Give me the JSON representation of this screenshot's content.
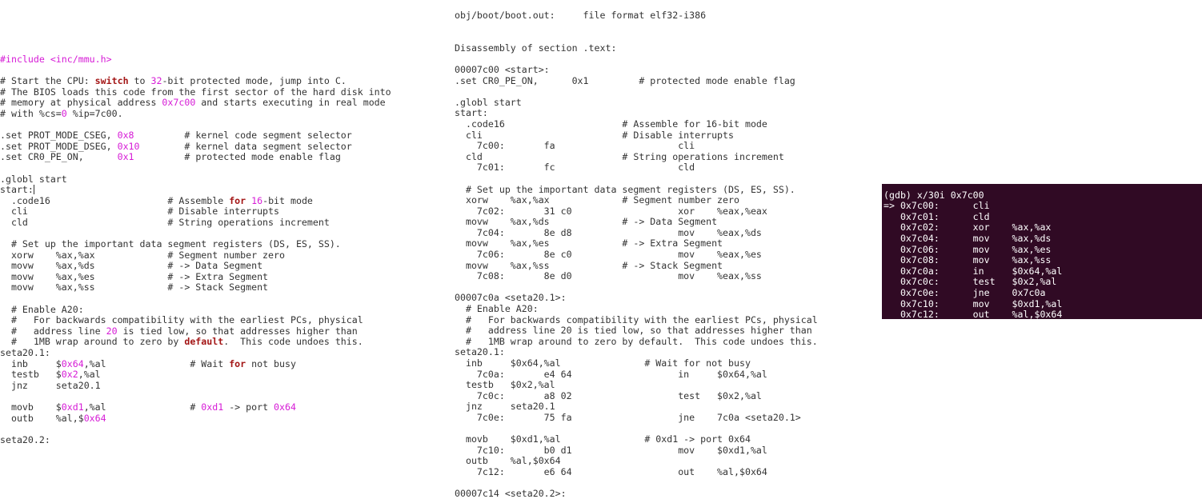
{
  "left_source": {
    "lines": [
      [
        {
          "t": "#include <inc/mmu.h>",
          "c": "pink"
        }
      ],
      [],
      [
        {
          "t": "# Start the CPU: "
        },
        {
          "t": "switch",
          "c": "kw"
        },
        {
          "t": " to "
        },
        {
          "t": "32",
          "c": "pink"
        },
        {
          "t": "-bit protected mode, jump into C."
        }
      ],
      [
        {
          "t": "# The BIOS loads this code from the first sector of the hard disk into"
        }
      ],
      [
        {
          "t": "# memory at physical address "
        },
        {
          "t": "0x7c00",
          "c": "pink"
        },
        {
          "t": " and starts executing in real mode"
        }
      ],
      [
        {
          "t": "# with %cs="
        },
        {
          "t": "0",
          "c": "pink"
        },
        {
          "t": " %ip=7c00."
        }
      ],
      [],
      [
        {
          "t": ".set PROT_MODE_CSEG, "
        },
        {
          "t": "0x8",
          "c": "pink"
        },
        {
          "t": "         # kernel code segment selector"
        }
      ],
      [
        {
          "t": ".set PROT_MODE_DSEG, "
        },
        {
          "t": "0x10",
          "c": "pink"
        },
        {
          "t": "        # kernel data segment selector"
        }
      ],
      [
        {
          "t": ".set CR0_PE_ON,      "
        },
        {
          "t": "0x1",
          "c": "pink"
        },
        {
          "t": "         # protected mode enable flag"
        }
      ],
      [],
      [
        {
          "t": ".globl start"
        }
      ],
      [
        {
          "t": "start:"
        },
        {
          "caret": true
        }
      ],
      [
        {
          "t": "  .code16                     # Assemble "
        },
        {
          "t": "for",
          "c": "kw"
        },
        {
          "t": " "
        },
        {
          "t": "16",
          "c": "pink"
        },
        {
          "t": "-bit mode"
        }
      ],
      [
        {
          "t": "  cli                         # Disable interrupts"
        }
      ],
      [
        {
          "t": "  cld                         # String operations increment"
        }
      ],
      [],
      [
        {
          "t": "  # Set up the important data segment registers (DS, ES, SS)."
        }
      ],
      [
        {
          "t": "  xorw    %ax,%ax             # Segment number zero"
        }
      ],
      [
        {
          "t": "  movw    %ax,%ds             # -> Data Segment"
        }
      ],
      [
        {
          "t": "  movw    %ax,%es             # -> Extra Segment"
        }
      ],
      [
        {
          "t": "  movw    %ax,%ss             # -> Stack Segment"
        }
      ],
      [],
      [
        {
          "t": "  # Enable A20:"
        }
      ],
      [
        {
          "t": "  #   For backwards compatibility with the earliest PCs, physical"
        }
      ],
      [
        {
          "t": "  #   address line "
        },
        {
          "t": "20",
          "c": "pink"
        },
        {
          "t": " is tied low, so that addresses higher than"
        }
      ],
      [
        {
          "t": "  #   1MB wrap around to zero by "
        },
        {
          "t": "default",
          "c": "kw"
        },
        {
          "t": ".  This code undoes this."
        }
      ],
      [
        {
          "t": "seta20.1:"
        }
      ],
      [
        {
          "t": "  inb     $"
        },
        {
          "t": "0x64",
          "c": "pink"
        },
        {
          "t": ",%al               # Wait "
        },
        {
          "t": "for",
          "c": "kw"
        },
        {
          "t": " not busy"
        }
      ],
      [
        {
          "t": "  testb   $"
        },
        {
          "t": "0x2",
          "c": "pink"
        },
        {
          "t": ",%al"
        }
      ],
      [
        {
          "t": "  jnz     seta20.1"
        }
      ],
      [],
      [
        {
          "t": "  movb    $"
        },
        {
          "t": "0xd1",
          "c": "pink"
        },
        {
          "t": ",%al               # "
        },
        {
          "t": "0xd1",
          "c": "pink"
        },
        {
          "t": " -> port "
        },
        {
          "t": "0x64",
          "c": "pink"
        }
      ],
      [
        {
          "t": "  outb    %al,$"
        },
        {
          "t": "0x64",
          "c": "pink"
        }
      ],
      [],
      [
        {
          "t": "seta20.2:"
        }
      ]
    ]
  },
  "objdump": {
    "lines": [
      "obj/boot/boot.out:     file format elf32-i386",
      "",
      "",
      "Disassembly of section .text:",
      "",
      "00007c00 <start>:",
      ".set CR0_PE_ON,      0x1         # protected mode enable flag",
      "",
      ".globl start",
      "start:",
      "  .code16                     # Assemble for 16-bit mode",
      "  cli                         # Disable interrupts",
      "    7c00:       fa                      cli",
      "  cld                         # String operations increment",
      "    7c01:       fc                      cld",
      "",
      "  # Set up the important data segment registers (DS, ES, SS).",
      "  xorw    %ax,%ax             # Segment number zero",
      "    7c02:       31 c0                   xor    %eax,%eax",
      "  movw    %ax,%ds             # -> Data Segment",
      "    7c04:       8e d8                   mov    %eax,%ds",
      "  movw    %ax,%es             # -> Extra Segment",
      "    7c06:       8e c0                   mov    %eax,%es",
      "  movw    %ax,%ss             # -> Stack Segment",
      "    7c08:       8e d0                   mov    %eax,%ss",
      "",
      "00007c0a <seta20.1>:",
      "  # Enable A20:",
      "  #   For backwards compatibility with the earliest PCs, physical",
      "  #   address line 20 is tied low, so that addresses higher than",
      "  #   1MB wrap around to zero by default.  This code undoes this.",
      "seta20.1:",
      "  inb     $0x64,%al               # Wait for not busy",
      "    7c0a:       e4 64                   in     $0x64,%al",
      "  testb   $0x2,%al",
      "    7c0c:       a8 02                   test   $0x2,%al",
      "  jnz     seta20.1",
      "    7c0e:       75 fa                   jne    7c0a <seta20.1>",
      "",
      "  movb    $0xd1,%al               # 0xd1 -> port 0x64",
      "    7c10:       b0 d1                   mov    $0xd1,%al",
      "  outb    %al,$0x64",
      "    7c12:       e6 64                   out    %al,$0x64",
      "",
      "00007c14 <seta20.2>:"
    ]
  },
  "gdb": {
    "lines": [
      "// "
    ]
  },
  "theme": {
    "pink": "#d61ad6",
    "keyword": "#a31515",
    "terminal_bg": "#300a24"
  }
}
